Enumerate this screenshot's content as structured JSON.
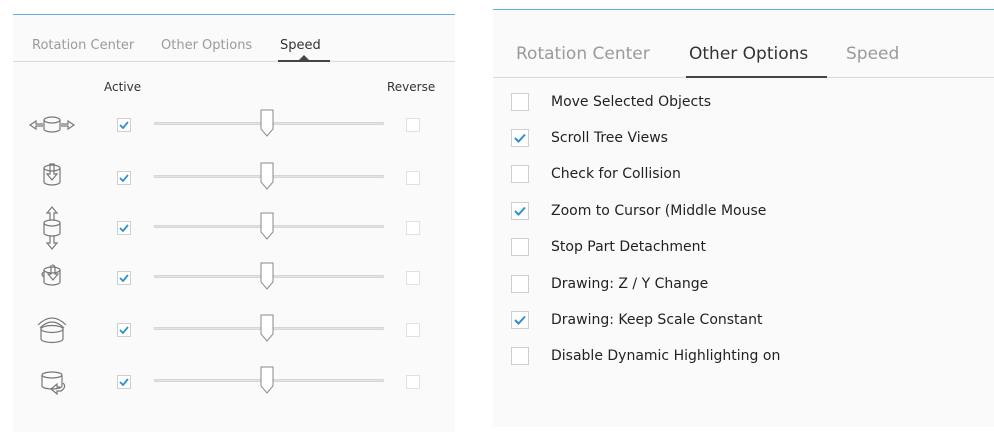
{
  "left_panel": {
    "tabs": [
      {
        "label": "Rotation Center",
        "active": false
      },
      {
        "label": "Other Options",
        "active": false
      },
      {
        "label": "Speed",
        "active": true
      }
    ],
    "columns": {
      "active": "Active",
      "reverse": "Reverse"
    },
    "rows": [
      {
        "icon": "pan-arrows-icon",
        "active": true,
        "speed": 0.49,
        "reverse": false
      },
      {
        "icon": "zoom-down-icon",
        "active": true,
        "speed": 0.49,
        "reverse": false
      },
      {
        "icon": "zoom-updown-icon",
        "active": true,
        "speed": 0.49,
        "reverse": false
      },
      {
        "icon": "tilt-icon",
        "active": true,
        "speed": 0.49,
        "reverse": false
      },
      {
        "icon": "roll-icon",
        "active": true,
        "speed": 0.49,
        "reverse": false
      },
      {
        "icon": "spin-icon",
        "active": true,
        "speed": 0.49,
        "reverse": false
      }
    ]
  },
  "right_panel": {
    "tabs": [
      {
        "label": "Rotation Center",
        "active": false
      },
      {
        "label": "Other Options",
        "active": true
      },
      {
        "label": "Speed",
        "active": false
      }
    ],
    "options": [
      {
        "label": "Move Selected Objects",
        "checked": false
      },
      {
        "label": "Scroll Tree Views",
        "checked": true
      },
      {
        "label": "Check for Collision",
        "checked": false
      },
      {
        "label": "Zoom to Cursor (Middle Mouse",
        "checked": true
      },
      {
        "label": "Stop Part Detachment",
        "checked": false
      },
      {
        "label": "Drawing: Z / Y Change",
        "checked": false
      },
      {
        "label": "Drawing: Keep Scale Constant",
        "checked": true
      },
      {
        "label": "Disable Dynamic Highlighting on",
        "checked": false
      }
    ]
  },
  "colors": {
    "check": "#2b8fd6",
    "accent_line": "#5ab4e0"
  }
}
